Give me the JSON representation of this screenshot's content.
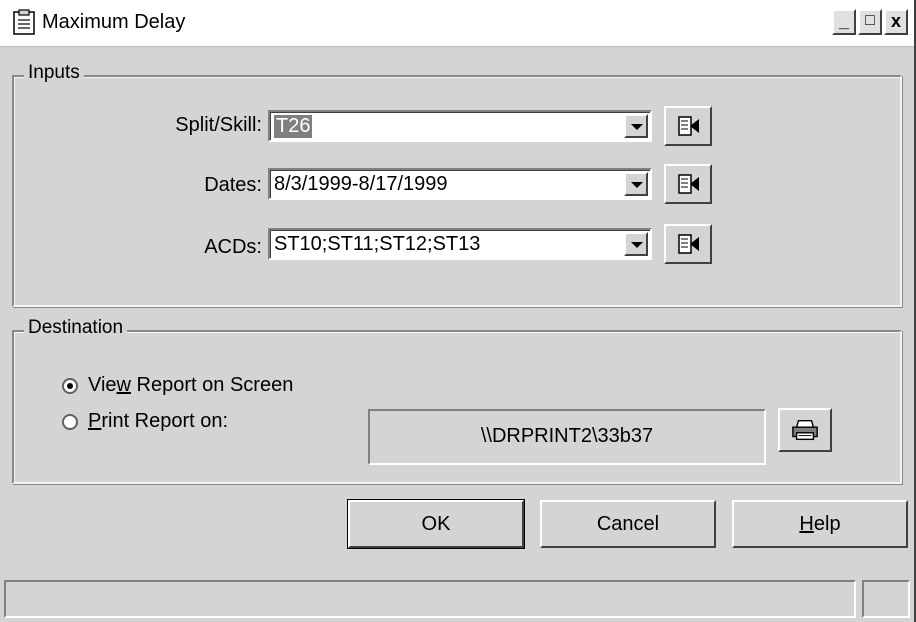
{
  "window": {
    "title": "Maximum Delay",
    "controls": {
      "minimize": "_",
      "maximize": "□",
      "close": "x"
    }
  },
  "inputs": {
    "group_label": "Inputs",
    "rows": [
      {
        "label": "Split/Skill:",
        "value": "T26",
        "selected": true
      },
      {
        "label": "Dates:",
        "value": "8/3/1999-8/17/1999",
        "selected": false
      },
      {
        "label": "ACDs:",
        "value": "ST10;ST11;ST12;ST13",
        "selected": false
      }
    ]
  },
  "destination": {
    "group_label": "Destination",
    "view_label_pre": "Vie",
    "view_label_ul": "w",
    "view_label_post": " Report on Screen",
    "view_checked": true,
    "print_label_ul": "P",
    "print_label_post": "rint Report on:",
    "print_checked": false,
    "printer": "\\\\DRPRINT2\\33b37"
  },
  "buttons": {
    "ok": "OK",
    "cancel": "Cancel",
    "help_ul": "H",
    "help_post": "elp"
  },
  "icons": {
    "app": "report-icon",
    "browse": "browse-list-icon",
    "printer": "printer-icon"
  }
}
